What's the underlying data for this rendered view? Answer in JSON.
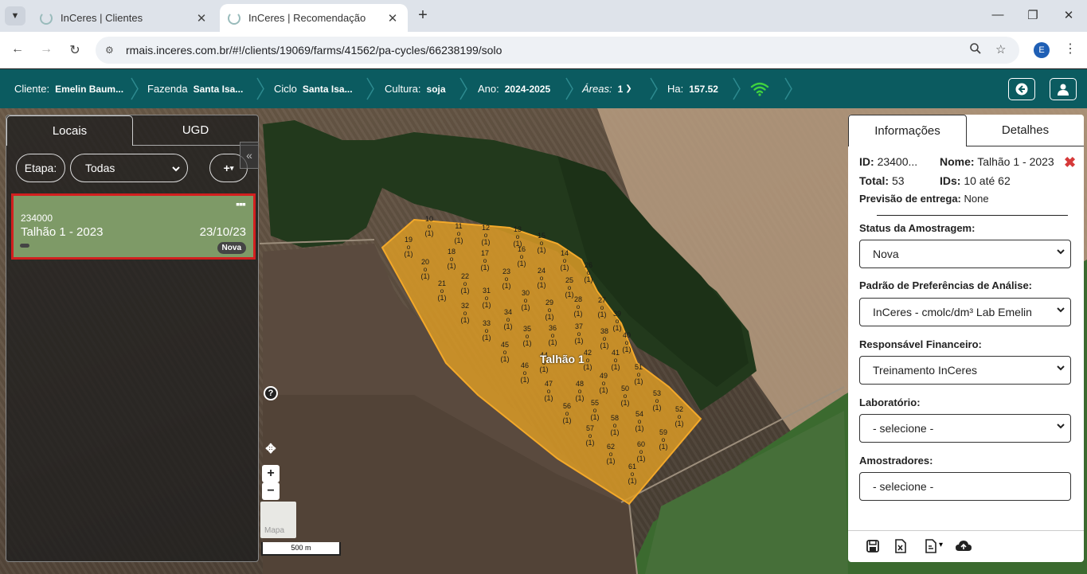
{
  "browser": {
    "tabs": [
      {
        "title": "InCeres | Clientes",
        "active": false
      },
      {
        "title": "InCeres | Recomendação",
        "active": true
      }
    ],
    "url": "rmais.inceres.com.br/#!/clients/19069/farms/41562/pa-cycles/66238199/solo",
    "profile_initial": "E"
  },
  "header": {
    "cliente_label": "Cliente:",
    "cliente_value": "Emelin Baum...",
    "fazenda_label": "Fazenda",
    "fazenda_value": "Santa Isa...",
    "ciclo_label": "Ciclo",
    "ciclo_value": "Santa Isa...",
    "cultura_label": "Cultura:",
    "cultura_value": "soja",
    "ano_label": "Ano:",
    "ano_value": "2024-2025",
    "areas_label": "Áreas:",
    "areas_value": "1",
    "ha_label": "Ha:",
    "ha_value": "157.52",
    "accent": "#0b5b60"
  },
  "left_panel": {
    "tabs": [
      "Locais",
      "UGD"
    ],
    "etapa_label": "Etapa:",
    "etapa_value": "Todas",
    "add_label": "+",
    "place": {
      "id": "234000",
      "name": "Talhão 1 - 2023",
      "date": "23/10/23",
      "badge": "Nova"
    }
  },
  "map": {
    "field_label": "Talhão 1",
    "scale_label": "500 m",
    "maptype_label": "Mapa",
    "help_label": "?",
    "zoom_in": "+",
    "zoom_out": "−",
    "points": [
      {
        "n": "10",
        "c": "(1)"
      },
      {
        "n": "11",
        "c": "(1)"
      },
      {
        "n": "12",
        "c": "(1)"
      },
      {
        "n": "13",
        "c": "(1)"
      },
      {
        "n": "15",
        "c": "(1)"
      },
      {
        "n": "19",
        "c": "(1)"
      },
      {
        "n": "18",
        "c": "(1)"
      },
      {
        "n": "17",
        "c": "(1)"
      },
      {
        "n": "16",
        "c": "(1)"
      },
      {
        "n": "14",
        "c": "(1)"
      },
      {
        "n": "20",
        "c": "(1)"
      },
      {
        "n": "22",
        "c": "(1)"
      },
      {
        "n": "23",
        "c": "(1)"
      },
      {
        "n": "24",
        "c": "(1)"
      },
      {
        "n": "26",
        "c": "(1)"
      },
      {
        "n": "21",
        "c": "(1)"
      },
      {
        "n": "31",
        "c": "(1)"
      },
      {
        "n": "30",
        "c": "(1)"
      },
      {
        "n": "25",
        "c": "(1)"
      },
      {
        "n": "32",
        "c": "(1)"
      },
      {
        "n": "29",
        "c": "(1)"
      },
      {
        "n": "28",
        "c": "(1)"
      },
      {
        "n": "27",
        "c": "(1)"
      },
      {
        "n": "34",
        "c": "(1)"
      },
      {
        "n": "33",
        "c": "(1)"
      },
      {
        "n": "35",
        "c": "(1)"
      },
      {
        "n": "36",
        "c": "(1)"
      },
      {
        "n": "37",
        "c": "(1)"
      },
      {
        "n": "38",
        "c": "(1)"
      },
      {
        "n": "39",
        "c": "(1)"
      },
      {
        "n": "40",
        "c": "(1)"
      },
      {
        "n": "45",
        "c": "(1)"
      },
      {
        "n": "44",
        "c": "(1)"
      },
      {
        "n": "42",
        "c": "(1)"
      },
      {
        "n": "41",
        "c": "(1)"
      },
      {
        "n": "46",
        "c": "(1)"
      },
      {
        "n": "51",
        "c": "(1)"
      },
      {
        "n": "47",
        "c": "(1)"
      },
      {
        "n": "48",
        "c": "(1)"
      },
      {
        "n": "49",
        "c": "(1)"
      },
      {
        "n": "50",
        "c": "(1)"
      },
      {
        "n": "53",
        "c": "(1)"
      },
      {
        "n": "55",
        "c": "(1)"
      },
      {
        "n": "56",
        "c": "(1)"
      },
      {
        "n": "52",
        "c": "(1)"
      },
      {
        "n": "58",
        "c": "(1)"
      },
      {
        "n": "54",
        "c": "(1)"
      },
      {
        "n": "57",
        "c": "(1)"
      },
      {
        "n": "59",
        "c": "(1)"
      },
      {
        "n": "62",
        "c": "(1)"
      },
      {
        "n": "60",
        "c": "(1)"
      },
      {
        "n": "61",
        "c": "(1)"
      }
    ]
  },
  "right_panel": {
    "tabs": [
      "Informações",
      "Detalhes"
    ],
    "id_label": "ID:",
    "id_value": "23400...",
    "nome_label": "Nome:",
    "nome_value": "Talhão 1 - 2023",
    "total_label": "Total:",
    "total_value": "53",
    "ids_label": "IDs:",
    "ids_value": "10 até 62",
    "previsao_label": "Previsão de entrega:",
    "previsao_value": "None",
    "status_label": "Status da Amostragem:",
    "status_value": "Nova",
    "padrao_label": "Padrão de Preferências de Análise:",
    "padrao_value": "InCeres - cmolc/dm³ Lab Emelin",
    "resp_label": "Responsável Financeiro:",
    "resp_value": "Treinamento InCeres",
    "lab_label": "Laboratório:",
    "lab_value": "- selecione -",
    "amostradores_label": "Amostradores:",
    "amostradores_value": "- selecione -"
  }
}
